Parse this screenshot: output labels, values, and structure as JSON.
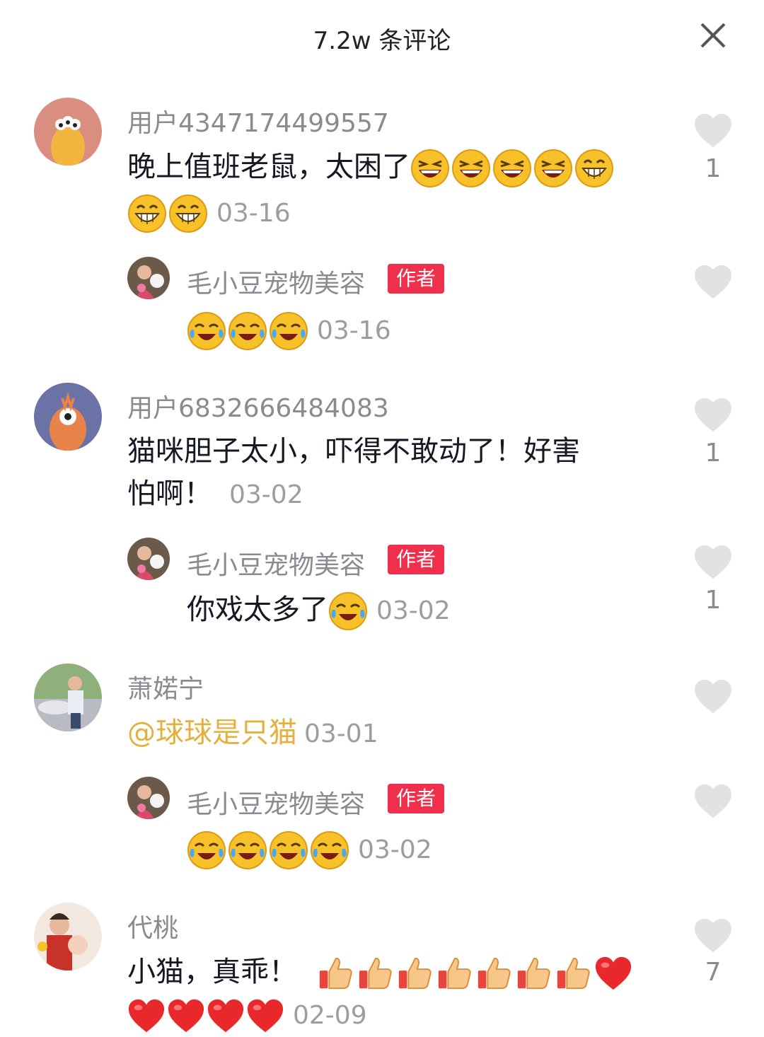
{
  "header": {
    "title": "7.2w 条评论"
  },
  "comments": [
    {
      "username": "用户4347174499557",
      "text": "晚上值班老鼠，太困了",
      "date": "03-16",
      "likes": "1",
      "reply": {
        "username": "毛小豆宠物美容",
        "badge": "作者",
        "date": "03-16"
      }
    },
    {
      "username": "用户6832666484083",
      "text_line1": "猫咪胆子太小，吓得不敢动了！好害",
      "text_line2": "怕啊！",
      "date": "03-02",
      "likes": "1",
      "reply": {
        "username": "毛小豆宠物美容",
        "badge": "作者",
        "text": "你戏太多了",
        "date": "03-02",
        "likes": "1"
      }
    },
    {
      "username": "萧婼宁",
      "mention": "@球球是只猫",
      "date": "03-01",
      "reply": {
        "username": "毛小豆宠物美容",
        "badge": "作者",
        "date": "03-02"
      }
    },
    {
      "username": "代桃",
      "text": "小猫，真乖！",
      "date": "02-09",
      "likes": "7"
    }
  ],
  "icons": {
    "close": "close-icon",
    "like": "heart-icon",
    "emoji_laugh": "laughing-emoji",
    "emoji_grin": "grinning-emoji",
    "emoji_tears": "tears-of-joy-emoji",
    "emoji_thumbsup": "thumbs-up-emoji",
    "emoji_heart": "red-heart-emoji"
  },
  "colors": {
    "badge": "#ef2f4c",
    "mention": "#e4b13f",
    "heart_inactive": "#e0e0e0"
  }
}
